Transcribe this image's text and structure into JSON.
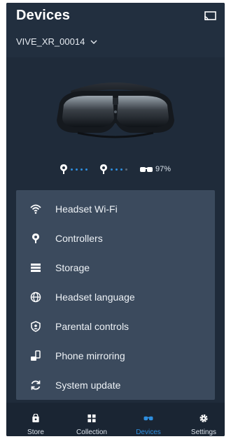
{
  "header": {
    "title": "Devices",
    "device_name": "VIVE_XR_00014"
  },
  "icons": {
    "cast": "cast-icon",
    "chevron": "chevron-down-icon"
  },
  "status": {
    "controllers": [
      {
        "icon": "controller-icon",
        "battery_dots_active": 4,
        "battery_dots_total": 4
      },
      {
        "icon": "controller-icon",
        "battery_dots_active": 3,
        "battery_dots_total": 4
      }
    ],
    "headset_battery": "97%"
  },
  "menu": {
    "items": [
      {
        "label": "Headset Wi-Fi",
        "icon": "wifi-icon"
      },
      {
        "label": "Controllers",
        "icon": "controller-icon"
      },
      {
        "label": "Storage",
        "icon": "storage-icon"
      },
      {
        "label": "Headset language",
        "icon": "globe-icon"
      },
      {
        "label": "Parental controls",
        "icon": "shield-icon"
      },
      {
        "label": "Phone mirroring",
        "icon": "phone-mirroring-icon"
      },
      {
        "label": "System update",
        "icon": "refresh-icon"
      }
    ]
  },
  "tabs": [
    {
      "label": "Store",
      "icon": "store-icon",
      "active": false
    },
    {
      "label": "Collection",
      "icon": "grid-icon",
      "active": false
    },
    {
      "label": "Devices",
      "icon": "headset-icon",
      "active": true
    },
    {
      "label": "Settings",
      "icon": "gear-icon",
      "active": false
    }
  ],
  "colors": {
    "accent": "#2e8fe0",
    "background": "#1f2b3a",
    "menu_bg": "#3b4a5d",
    "tab_bg": "#1a2533"
  }
}
